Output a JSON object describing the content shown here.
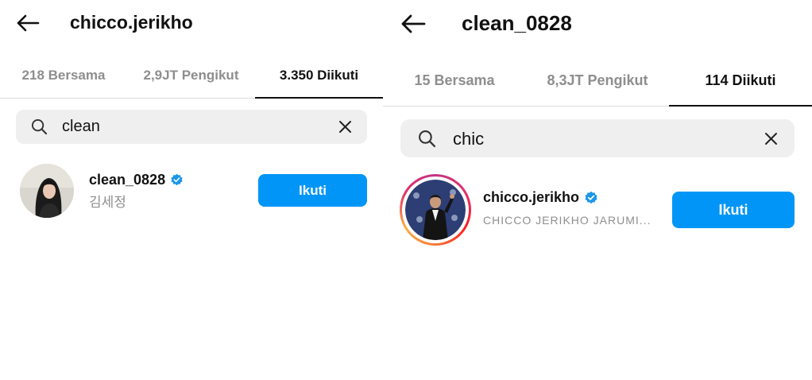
{
  "left": {
    "title": "chicco.jerikho",
    "tabs": [
      {
        "label": "218 Bersama"
      },
      {
        "label": "2,9JT Pengikut"
      },
      {
        "label": "3.350 Diikuti"
      }
    ],
    "active_tab": 2,
    "search": {
      "value": "clean"
    },
    "result": {
      "username": "clean_0828",
      "subtitle": "김세정",
      "verified": true,
      "follow_label": "Ikuti"
    }
  },
  "right": {
    "title": "clean_0828",
    "tabs": [
      {
        "label": "15 Bersama"
      },
      {
        "label": "8,3JT Pengikut"
      },
      {
        "label": "114 Diikuti"
      }
    ],
    "active_tab": 2,
    "search": {
      "value": "chic"
    },
    "result": {
      "username": "chicco.jerikho",
      "subtitle": "CHICCO JERIKHO JARUMI...",
      "verified": true,
      "follow_label": "Ikuti"
    }
  },
  "icons": {
    "back": "arrow-left-icon",
    "search": "search-icon",
    "clear": "close-icon",
    "verified": "verified-badge-icon"
  },
  "colors": {
    "accent": "#0095f6",
    "verified": "#1c96e8",
    "muted_text": "#8e8e8e",
    "search_bg": "#efefef"
  }
}
